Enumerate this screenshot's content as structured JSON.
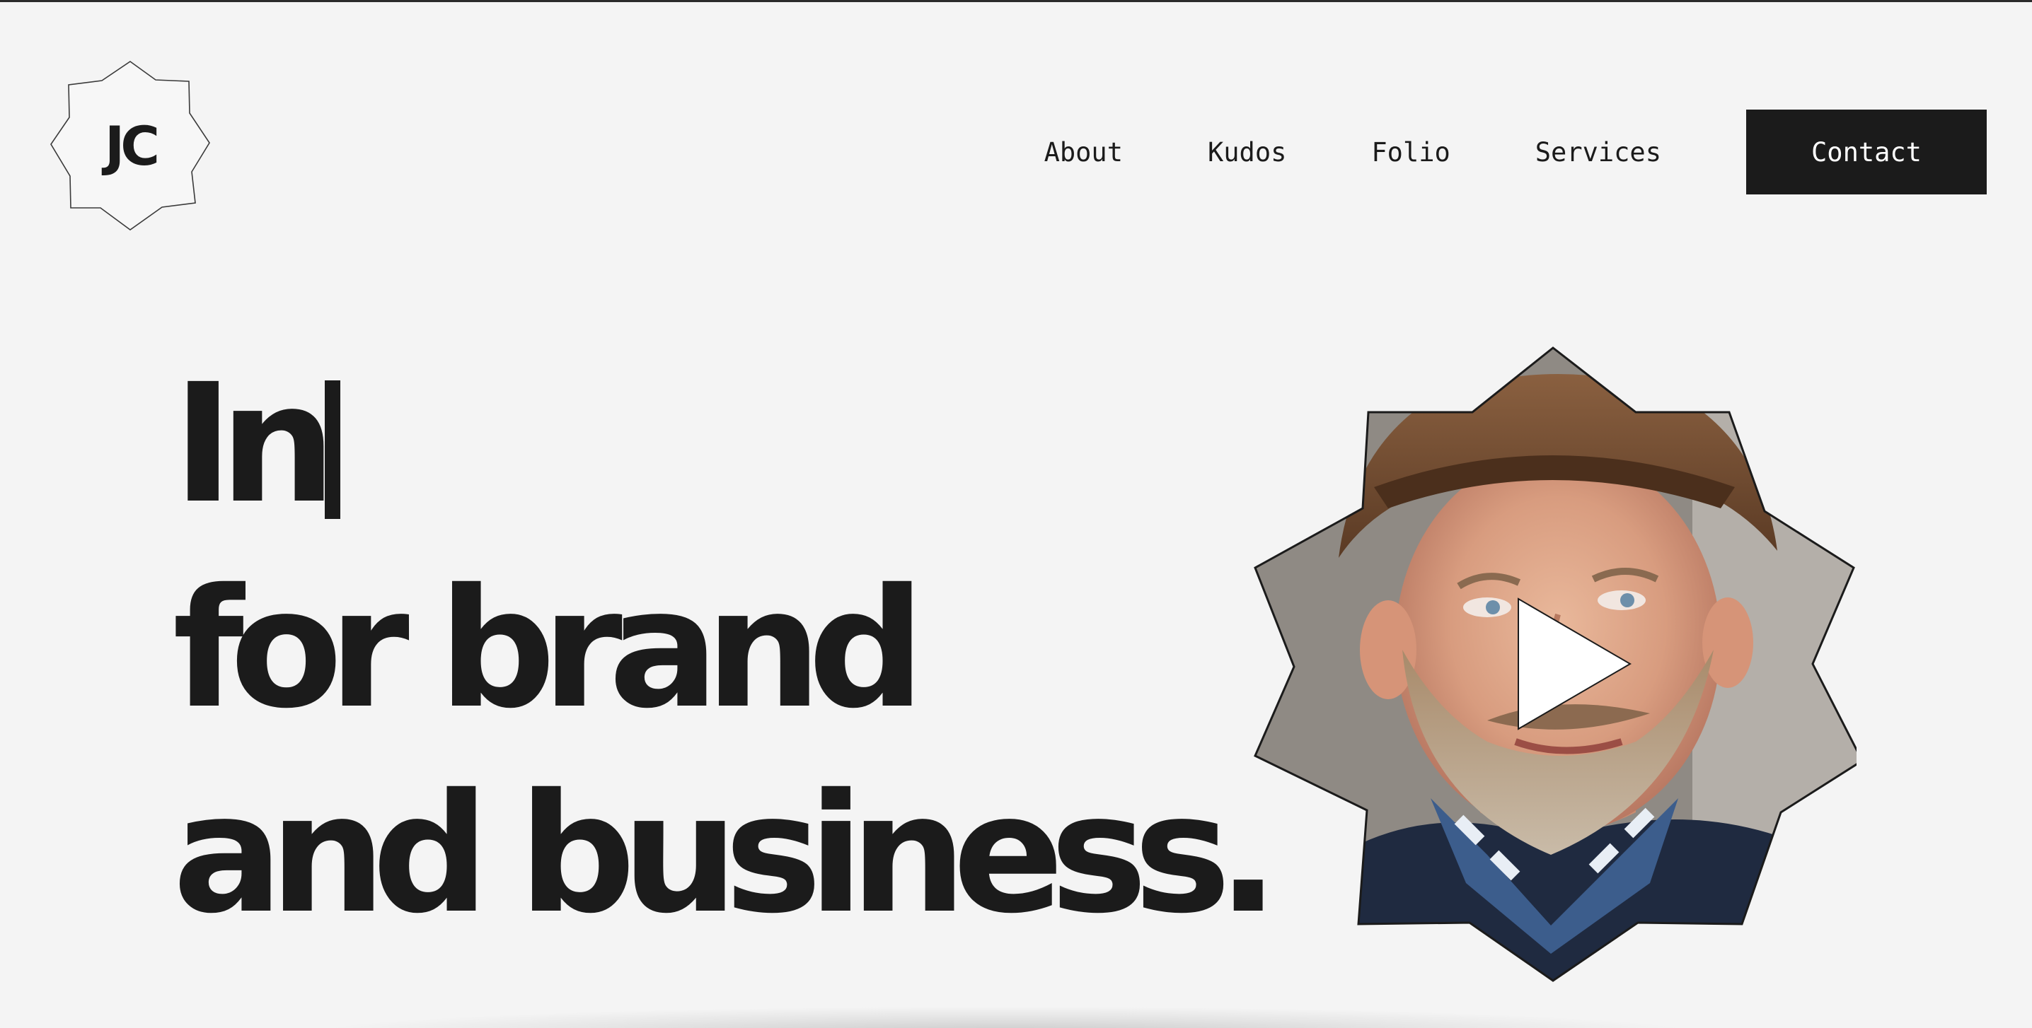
{
  "logo": {
    "text": "JC"
  },
  "nav": {
    "links": [
      {
        "label": "About"
      },
      {
        "label": "Kudos"
      },
      {
        "label": "Folio"
      },
      {
        "label": "Services"
      }
    ],
    "contact_label": "Contact"
  },
  "hero": {
    "line1": "In",
    "line2": "for brand",
    "line3": "and business."
  },
  "video": {
    "icon": "play-icon",
    "image": "portrait-of-bearded-man-in-brown-hat"
  },
  "colors": {
    "background": "#f4f4f4",
    "text": "#1b1b1b",
    "button_bg": "#1b1b1b",
    "button_text": "#ffffff"
  }
}
